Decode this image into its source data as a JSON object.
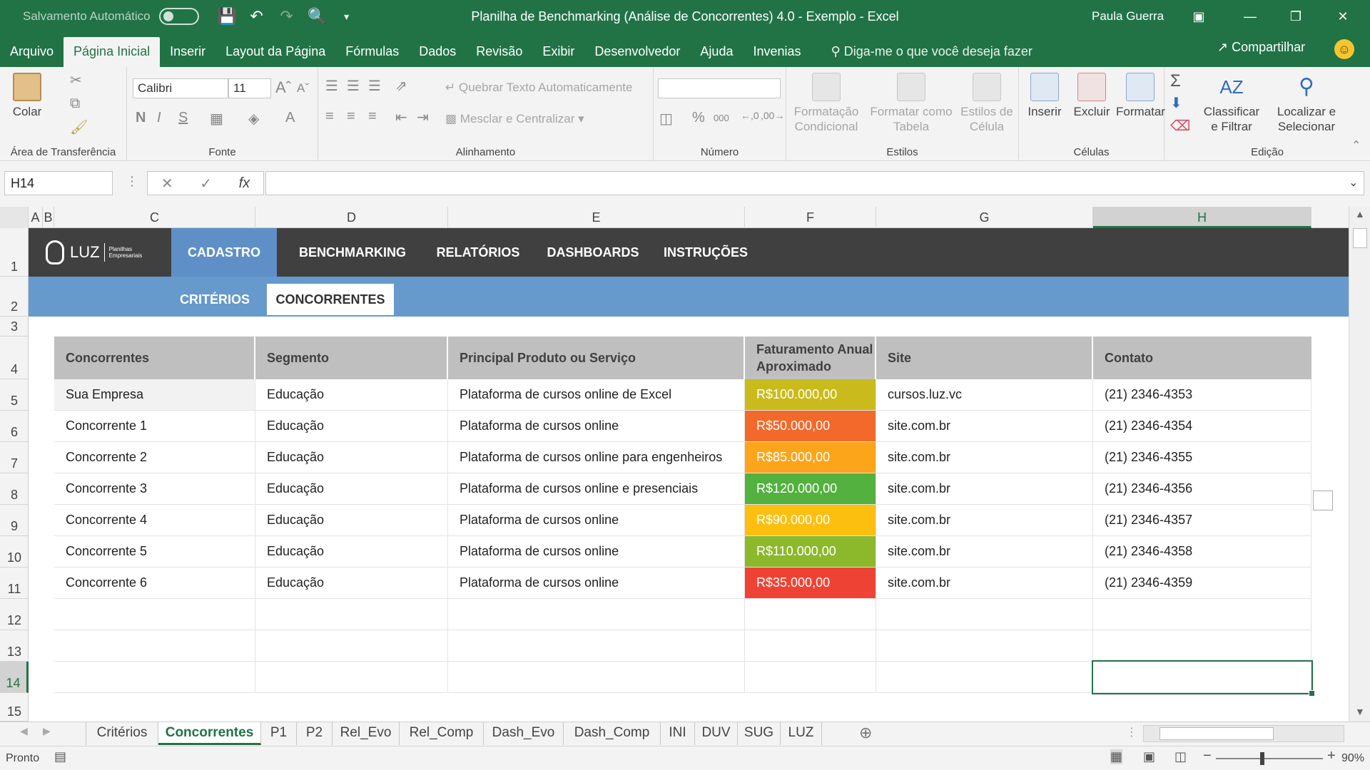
{
  "titlebar": {
    "autosave_label": "Salvamento Automático",
    "title": "Planilha de Benchmarking (Análise de Concorrentes) 4.0 - Exemplo  -  Excel",
    "user": "Paula Guerra"
  },
  "ribbon_tabs": [
    "Arquivo",
    "Página Inicial",
    "Inserir",
    "Layout da Página",
    "Fórmulas",
    "Dados",
    "Revisão",
    "Exibir",
    "Desenvolvedor",
    "Ajuda",
    "Invenias"
  ],
  "ribbon_search": "Diga-me o que você deseja fazer",
  "share_label": "Compartilhar",
  "ribbon": {
    "clipboard": {
      "paste": "Colar",
      "label": "Área de Transferência"
    },
    "font": {
      "name": "Calibri",
      "size": "11",
      "label": "Fonte"
    },
    "alignment": {
      "wrap": "Quebrar Texto Automaticamente",
      "merge": "Mesclar e Centralizar",
      "label": "Alinhamento"
    },
    "number": {
      "label": "Número",
      "percent": "%",
      "thousands": "000"
    },
    "styles": {
      "conditional_1": "Formatação",
      "conditional_2": "Condicional",
      "table_1": "Formatar como",
      "table_2": "Tabela",
      "cell_1": "Estilos de",
      "cell_2": "Célula",
      "label": "Estilos"
    },
    "cells": {
      "insert": "Inserir",
      "delete": "Excluir",
      "format": "Formatar",
      "label": "Células"
    },
    "editing": {
      "sort_1": "Classificar",
      "sort_2": "e Filtrar",
      "find_1": "Localizar e",
      "find_2": "Selecionar",
      "label": "Edição"
    }
  },
  "formula_bar": {
    "name_box": "H14",
    "fx": "fx",
    "value": ""
  },
  "columns": [
    "A",
    "B",
    "C",
    "D",
    "E",
    "F",
    "G",
    "H"
  ],
  "rows": [
    "1",
    "2",
    "3",
    "4",
    "5",
    "6",
    "7",
    "8",
    "9",
    "10",
    "11",
    "12",
    "13",
    "14",
    "15"
  ],
  "nav": {
    "logo_text": "LUZ",
    "logo_sub": "Planilhas Empresariais",
    "items": [
      "CADASTRO",
      "BENCHMARKING",
      "RELATÓRIOS",
      "DASHBOARDS",
      "INSTRUÇÕES"
    ],
    "sub_items": [
      "CRITÉRIOS",
      "CONCORRENTES"
    ]
  },
  "table": {
    "headers": [
      "Concorrentes",
      "Segmento",
      "Principal Produto ou Serviço",
      "Faturamento Anual Aproximado",
      "Site",
      "Contato"
    ],
    "rows": [
      [
        "Sua Empresa",
        "Educação",
        "Plataforma de cursos online de Excel",
        "R$100.000,00",
        "cursos.luz.vc",
        "(21) 2346-4353"
      ],
      [
        "Concorrente 1",
        "Educação",
        "Plataforma de cursos online",
        "R$50.000,00",
        "site.com.br",
        "(21) 2346-4354"
      ],
      [
        "Concorrente 2",
        "Educação",
        "Plataforma de cursos online para engenheiros",
        "R$85.000,00",
        "site.com.br",
        "(21) 2346-4355"
      ],
      [
        "Concorrente 3",
        "Educação",
        "Plataforma de cursos online e presenciais",
        "R$120.000,00",
        "site.com.br",
        "(21) 2346-4356"
      ],
      [
        "Concorrente 4",
        "Educação",
        "Plataforma de cursos online",
        "R$90.000,00",
        "site.com.br",
        "(21) 2346-4357"
      ],
      [
        "Concorrente 5",
        "Educação",
        "Plataforma de cursos online",
        "R$110.000,00",
        "site.com.br",
        "(21) 2346-4358"
      ],
      [
        "Concorrente 6",
        "Educação",
        "Plataforma de cursos online",
        "R$35.000,00",
        "site.com.br",
        "(21) 2346-4359"
      ]
    ],
    "revenue_colors": [
      "#c9bb1c",
      "#f2692b",
      "#fca51a",
      "#53b13f",
      "#fdbf0f",
      "#8cb82c",
      "#ee4334"
    ]
  },
  "sheet_tabs": [
    "Critérios",
    "Concorrentes",
    "P1",
    "P2",
    "Rel_Evo",
    "Rel_Comp",
    "Dash_Evo",
    "Dash_Comp",
    "INI",
    "DUV",
    "SUG",
    "LUZ"
  ],
  "status": {
    "ready": "Pronto",
    "zoom": "90%"
  },
  "colors": {
    "excel_green": "#217346",
    "nav_dark": "#404040",
    "nav_blue": "#6699cc"
  }
}
